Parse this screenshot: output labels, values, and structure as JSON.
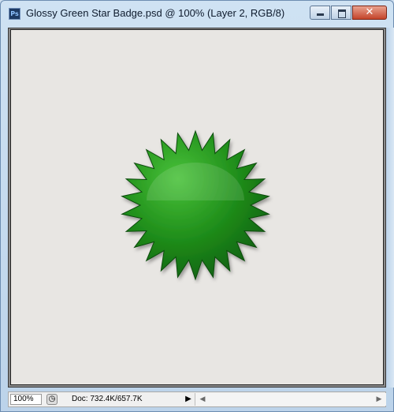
{
  "window": {
    "title": "Glossy Green Star Badge.psd @ 100% (Layer 2, RGB/8)",
    "app_icon_text": "Ps",
    "controls": {
      "minimize": "minimize-icon",
      "maximize": "maximize-icon",
      "close": "close-icon",
      "close_glyph": "✕"
    }
  },
  "canvas": {
    "background": "#e8e6e3",
    "badge": {
      "color": "#1f8d1a",
      "highlight": "#49c23a",
      "shadow": "#0f5f10",
      "points": 26
    }
  },
  "statusbar": {
    "zoom": "100%",
    "doc_info": "Doc: 732.4K/657.7K",
    "status_icon": "◷",
    "menu_arrow": "▶",
    "scroll_left": "◀",
    "scroll_right": "▶"
  }
}
